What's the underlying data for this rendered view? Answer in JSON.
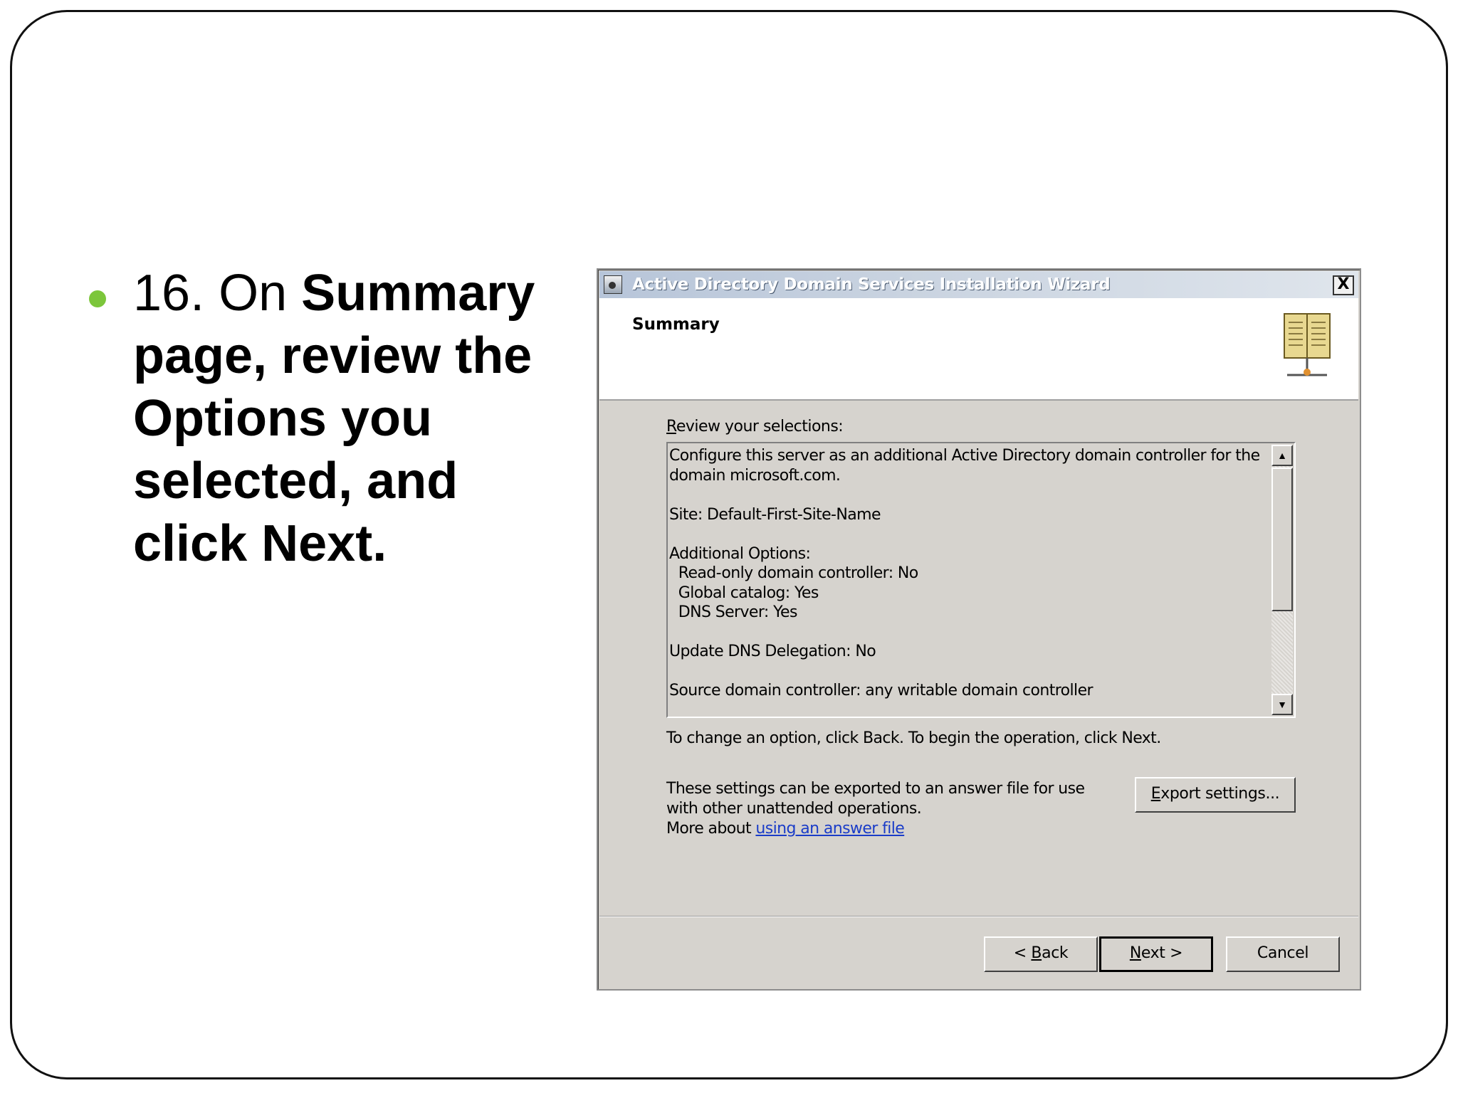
{
  "slide": {
    "bullet": {
      "number": "16.",
      "prefix": "On",
      "bold_1": "Summary page, review the Options you selected, and click Next."
    }
  },
  "dialog": {
    "title": "Active Directory Domain Services Installation Wizard",
    "close_label": "X",
    "page_heading": "Summary",
    "review_label_underlined": "R",
    "review_label_rest": "eview your selections:",
    "summary_text": "Configure this server as an additional Active Directory domain controller for the\ndomain microsoft.com.\n\nSite: Default-First-Site-Name\n\nAdditional Options:\n  Read-only domain controller: No\n  Global catalog: Yes\n  DNS Server: Yes\n\nUpdate DNS Delegation: No\n\nSource domain controller: any writable domain controller",
    "change_hint": "To change an option, click Back. To begin the operation, click Next.",
    "export_text": "These settings can be exported to an answer file for use with other unattended operations.",
    "more_about": "More about ",
    "answer_link": "using an answer file",
    "buttons": {
      "export_ul": "E",
      "export_rest": "xport settings...",
      "back_prefix": "< ",
      "back_ul": "B",
      "back_rest": "ack",
      "next_ul": "N",
      "next_rest": "ext >",
      "cancel": "Cancel"
    },
    "colors": {
      "dialog_bg": "#d6d3ce",
      "title_bar": "#c9d3e0",
      "link": "#1a3cc8",
      "bullet": "#7cc63b"
    },
    "icons": [
      "wizard-app-icon",
      "close-icon",
      "directory-book-icon",
      "scroll-up-icon",
      "scroll-down-icon"
    ]
  }
}
